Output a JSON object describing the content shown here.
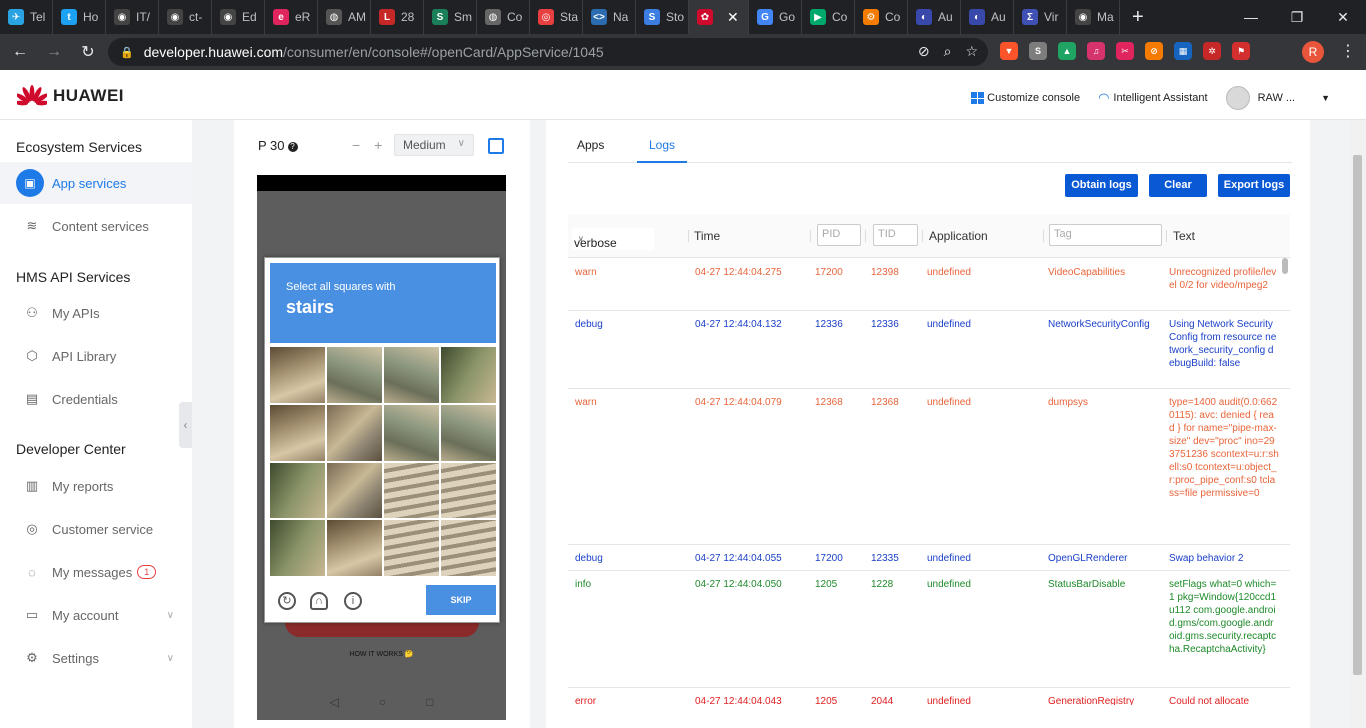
{
  "browser": {
    "tabs": [
      {
        "label": "Tel",
        "color": "#2aa3e2",
        "glyph": "✈"
      },
      {
        "label": "Ho",
        "color": "#1da1f2",
        "glyph": "t"
      },
      {
        "label": "IT/",
        "color": "#444",
        "glyph": "◉"
      },
      {
        "label": "ct-",
        "color": "#444",
        "glyph": "◉"
      },
      {
        "label": "Ed",
        "color": "#444",
        "glyph": "◉"
      },
      {
        "label": "eR",
        "color": "#e0245e",
        "glyph": "e"
      },
      {
        "label": "AM",
        "color": "#555",
        "glyph": "◍"
      },
      {
        "label": "28",
        "color": "#c62828",
        "glyph": "L"
      },
      {
        "label": "Sm",
        "color": "#1b7f5a",
        "glyph": "S"
      },
      {
        "label": "Co",
        "color": "#666",
        "glyph": "◍"
      },
      {
        "label": "Sta",
        "color": "#e84040",
        "glyph": "◎"
      },
      {
        "label": "Na",
        "color": "#2b6cb0",
        "glyph": "<>"
      },
      {
        "label": "Sto",
        "color": "#3b7de0",
        "glyph": "S"
      },
      {
        "label": "",
        "color": "#cf0a2c",
        "glyph": "✿",
        "active": true
      },
      {
        "label": "Go",
        "color": "#4285f4",
        "glyph": "G"
      },
      {
        "label": "Co",
        "color": "#00a86b",
        "glyph": "▶"
      },
      {
        "label": "Co",
        "color": "#f57c00",
        "glyph": "⚙"
      },
      {
        "label": "Au",
        "color": "#3949ab",
        "glyph": "◐"
      },
      {
        "label": "Au",
        "color": "#3949ab",
        "glyph": "◐"
      },
      {
        "label": "Vir",
        "color": "#3f51b5",
        "glyph": "Σ"
      },
      {
        "label": "Ma",
        "color": "#444",
        "glyph": "◉"
      }
    ],
    "close_glyph": "✕",
    "new_tab_glyph": "+",
    "url_host": "developer.huawei.com",
    "url_path": "/consumer/en/console#/openCard/AppService/1045",
    "profile_initial": "R"
  },
  "header": {
    "brand": "HUAWEI",
    "customize_console": "Customize console",
    "assistant": "Intelligent Assistant",
    "user_name": "RAW ..."
  },
  "sidebar": {
    "sections": [
      {
        "title": "Ecosystem Services"
      },
      {
        "title": "HMS API Services"
      },
      {
        "title": "Developer Center"
      }
    ],
    "items": [
      {
        "label": "App services",
        "icon": "app-icon"
      },
      {
        "label": "Content services",
        "icon": "layers-icon"
      },
      {
        "label": "My APIs",
        "icon": "user-api-icon"
      },
      {
        "label": "API Library",
        "icon": "cube-icon"
      },
      {
        "label": "Credentials",
        "icon": "document-icon"
      },
      {
        "label": "My reports",
        "icon": "bar-chart-icon"
      },
      {
        "label": "Customer service",
        "icon": "headset-icon"
      },
      {
        "label": "My messages",
        "icon": "chat-icon",
        "badge": "1"
      },
      {
        "label": "My account",
        "icon": "wallet-icon"
      },
      {
        "label": "Settings",
        "icon": "gear-icon"
      }
    ]
  },
  "device": {
    "name": "P 30",
    "help_glyph": "?",
    "zoom_out": "−",
    "zoom_in": "+",
    "size": "Medium",
    "captcha_prompt": "Select all squares with",
    "captcha_target": "stairs",
    "skip": "SKIP",
    "how_it_works": "HOW IT WORKS 🤔",
    "nav": [
      "◁",
      "○",
      "□"
    ]
  },
  "logs": {
    "tabs": [
      "Apps",
      "Logs"
    ],
    "active_tab": "Logs",
    "buttons": {
      "obtain": "Obtain logs",
      "clear": "Clear",
      "export": "Export logs"
    },
    "columns": {
      "level": "verbose",
      "time": "Time",
      "pid_placeholder": "PID",
      "tid_placeholder": "TID",
      "application": "Application",
      "tag_placeholder": "Tag",
      "text": "Text"
    },
    "rows": [
      {
        "level": "warn",
        "time": "04-27 12:44:04.275",
        "pid": "17200",
        "tid": "12398",
        "app": "undefined",
        "tag": "VideoCapabilities",
        "text": "Unrecognized profile/level 0/2 for video/mpeg2"
      },
      {
        "level": "debug",
        "time": "04-27 12:44:04.132",
        "pid": "12336",
        "tid": "12336",
        "app": "undefined",
        "tag": "NetworkSecurityConfig",
        "text": "Using Network Security Config from resource network_security_config debugBuild: false"
      },
      {
        "level": "warn",
        "time": "04-27 12:44:04.079",
        "pid": "12368",
        "tid": "12368",
        "app": "undefined",
        "tag": "dumpsys",
        "text": "type=1400 audit(0.0:6620115): avc: denied { read } for name=\"pipe-max-size\" dev=\"proc\" ino=293751236 scontext=u:r:shell:s0 tcontext=u:object_r:proc_pipe_conf:s0 tclass=file permissive=0"
      },
      {
        "level": "debug",
        "time": "04-27 12:44:04.055",
        "pid": "17200",
        "tid": "12335",
        "app": "undefined",
        "tag": "OpenGLRenderer",
        "text": "Swap behavior 2"
      },
      {
        "level": "info",
        "time": "04-27 12:44:04.050",
        "pid": "1205",
        "tid": "1228",
        "app": "undefined",
        "tag": "StatusBarDisable",
        "text": "setFlags what=0 which=1 pkg=Window{120ccd1 u112 com.google.android.gms/com.google.android.gms.security.recaptcha.RecaptchaActivity}"
      },
      {
        "level": "error",
        "time": "04-27 12:44:04.043",
        "pid": "1205",
        "tid": "2044",
        "app": "undefined",
        "tag": "GenerationRegistry",
        "text": "Could not allocate"
      }
    ]
  }
}
